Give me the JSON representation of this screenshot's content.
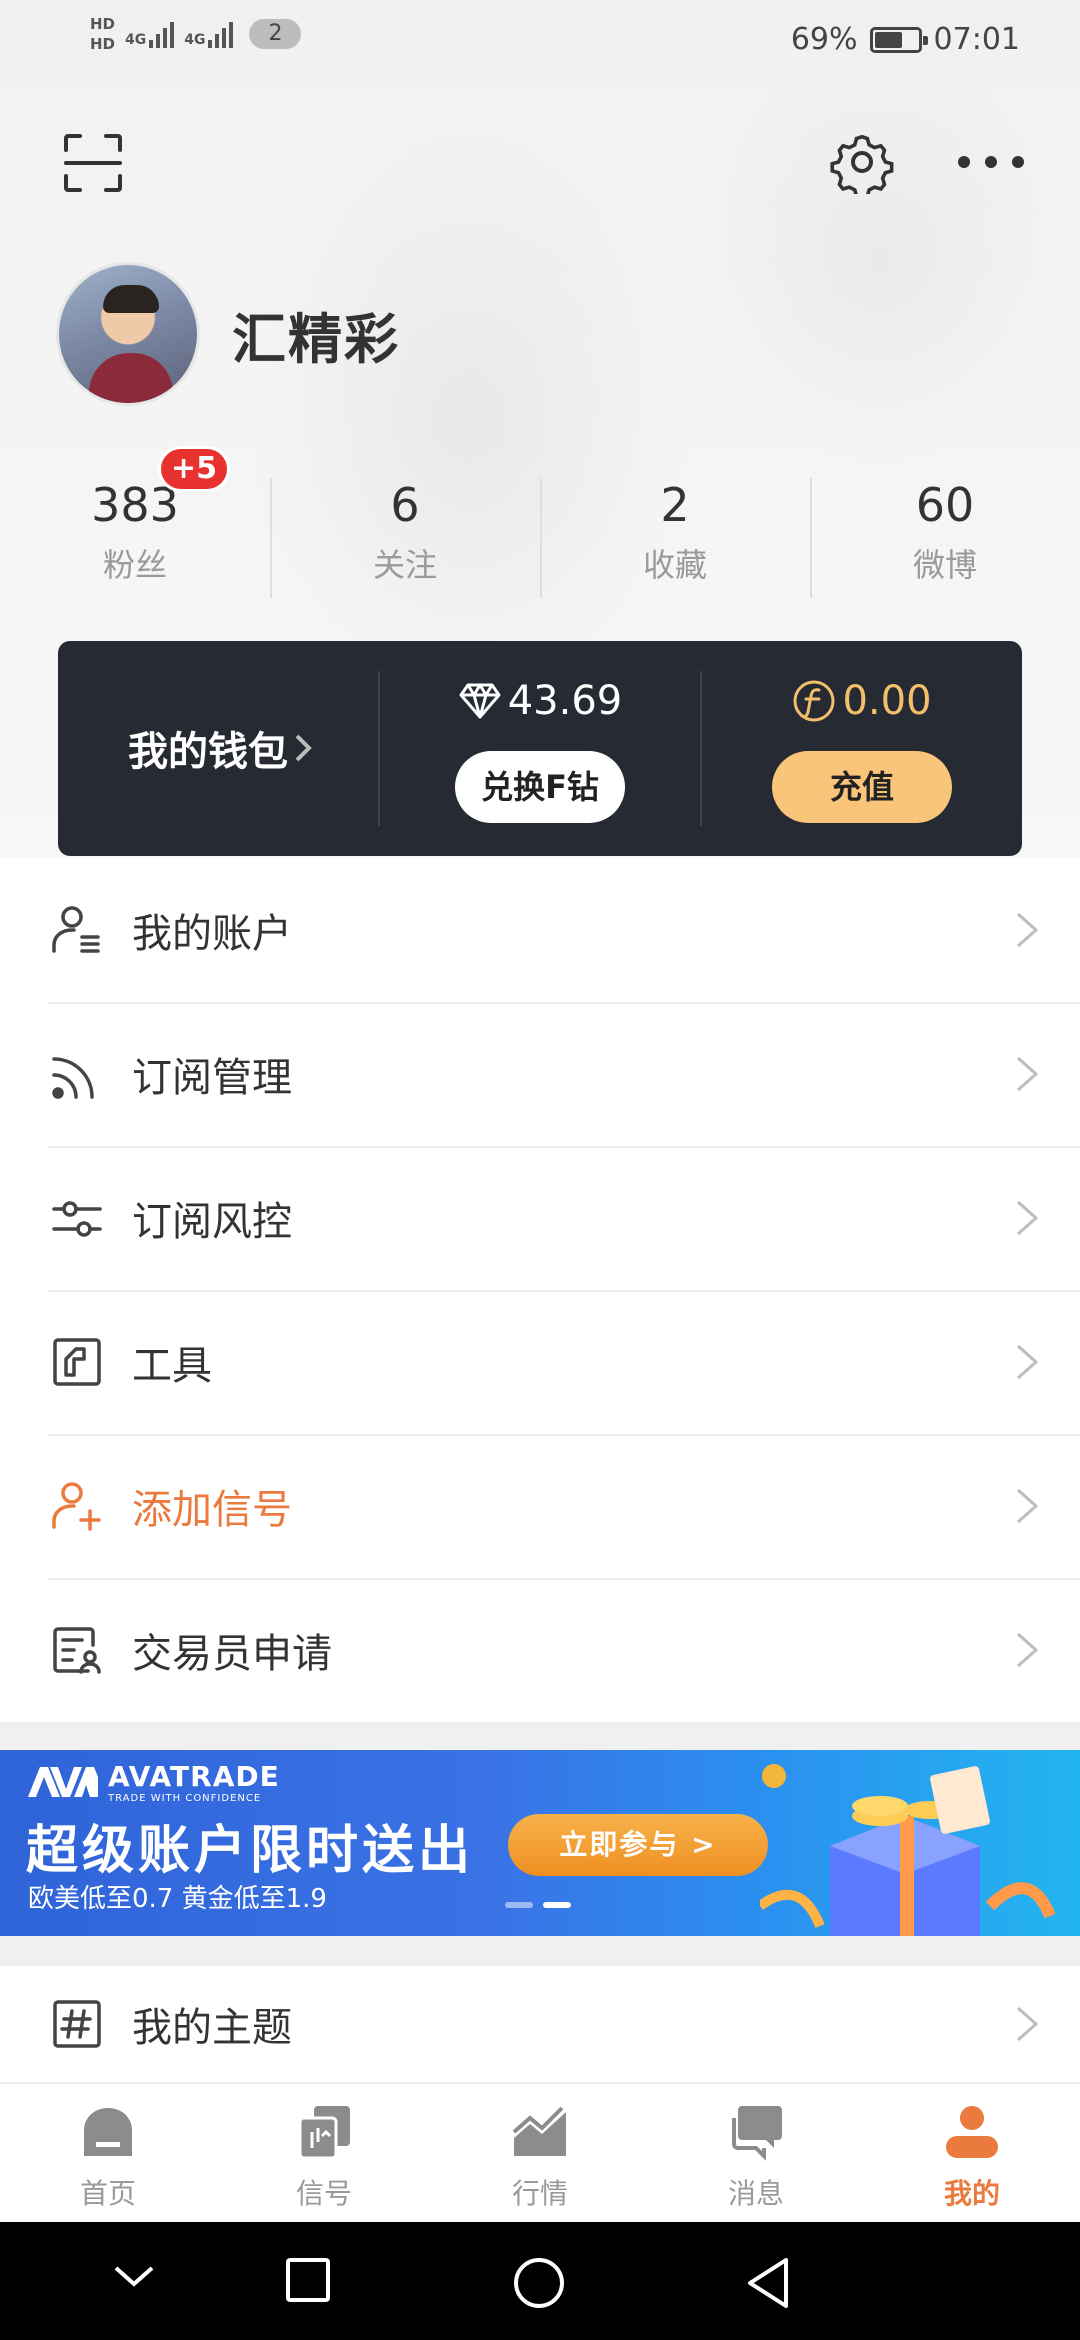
{
  "status_bar": {
    "hd1": "HD",
    "hd2": "HD",
    "net1": "4G",
    "net2": "4G",
    "sim_badge": "2",
    "battery_level": 0.69,
    "battery": "69%",
    "time": "07:01"
  },
  "profile": {
    "name": "汇精彩"
  },
  "stats": [
    {
      "value": "383",
      "label": "粉丝",
      "badge": "+5"
    },
    {
      "value": "6",
      "label": "关注"
    },
    {
      "value": "2",
      "label": "收藏"
    },
    {
      "value": "60",
      "label": "微博"
    }
  ],
  "wallet": {
    "title": "我的钱包",
    "diamond_amount": "43.69",
    "exchange_label": "兑换F钻",
    "coin_amount": "0.00",
    "recharge_label": "充值",
    "colors": {
      "card": "#262a33",
      "gold": "#f4bf6a",
      "button_gold": "#f9c57a"
    }
  },
  "menu": [
    {
      "label": "我的账户",
      "icon": "account-icon"
    },
    {
      "label": "订阅管理",
      "icon": "rss-icon"
    },
    {
      "label": "订阅风控",
      "icon": "sliders-icon"
    },
    {
      "label": "工具",
      "icon": "tools-icon"
    },
    {
      "label": "添加信号",
      "icon": "add-user-icon",
      "accent": "#ea7a3e"
    },
    {
      "label": "交易员申请",
      "icon": "trader-card-icon"
    },
    {
      "label": "我的主题",
      "icon": "hashtag-icon"
    }
  ],
  "banner": {
    "logo": "AVATRADE",
    "logo_tag": "TRADE WITH CONFIDENCE",
    "title": "超级账户限时送出",
    "subtitle": "欧美低至0.7 黄金低至1.9",
    "cta": "立即参与 >"
  },
  "nav": [
    {
      "label": "首页",
      "icon": "home-icon"
    },
    {
      "label": "信号",
      "icon": "signal-icon"
    },
    {
      "label": "行情",
      "icon": "market-chart-icon"
    },
    {
      "label": "消息",
      "icon": "message-icon"
    },
    {
      "label": "我的",
      "icon": "profile-icon",
      "active": true
    }
  ],
  "accent_color": "#ea7a3e"
}
